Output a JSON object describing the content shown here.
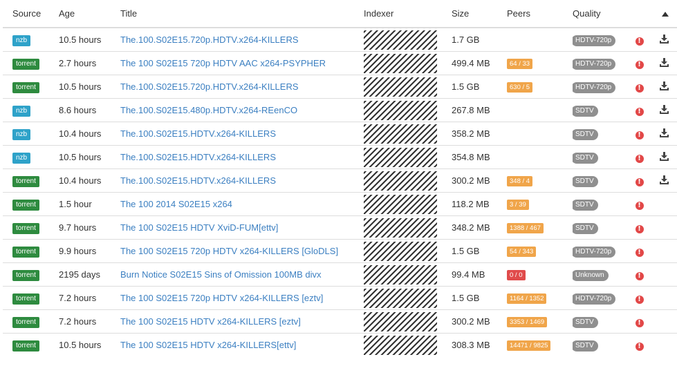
{
  "headers": {
    "source": "Source",
    "age": "Age",
    "title": "Title",
    "indexer": "Indexer",
    "size": "Size",
    "peers": "Peers",
    "quality": "Quality"
  },
  "colors": {
    "nzb": "#2ea2c9",
    "torrent": "#2e8b3f",
    "title_link": "#3b7fc1",
    "peers_warning": "#f0a54a",
    "peers_danger": "#e04b4b",
    "quality_badge": "#8f8f8f",
    "warning_icon": "#e24747"
  },
  "releases": [
    {
      "source": "nzb",
      "age": "10.5 hours",
      "title": "The.100.S02E15.720p.HDTV.x264-KILLERS",
      "size": "1.7 GB",
      "peers": "",
      "peers_status": "",
      "quality": "HDTV-720p",
      "download": true
    },
    {
      "source": "torrent",
      "age": "2.7 hours",
      "title": "The 100 S02E15 720p HDTV AAC x264-PSYPHER",
      "size": "499.4 MB",
      "peers": "64 / 33",
      "peers_status": "warning",
      "quality": "HDTV-720p",
      "download": true
    },
    {
      "source": "torrent",
      "age": "10.5 hours",
      "title": "The.100.S02E15.720p.HDTV.x264-KILLERS",
      "size": "1.5 GB",
      "peers": "630 / 5",
      "peers_status": "warning",
      "quality": "HDTV-720p",
      "download": true
    },
    {
      "source": "nzb",
      "age": "8.6 hours",
      "title": "The.100.S02E15.480p.HDTV.x264-REenCO",
      "size": "267.8 MB",
      "peers": "",
      "peers_status": "",
      "quality": "SDTV",
      "download": true
    },
    {
      "source": "nzb",
      "age": "10.4 hours",
      "title": "The.100.S02E15.HDTV.x264-KILLERS",
      "size": "358.2 MB",
      "peers": "",
      "peers_status": "",
      "quality": "SDTV",
      "download": true
    },
    {
      "source": "nzb",
      "age": "10.5 hours",
      "title": "The.100.S02E15.HDTV.x264-KILLERS",
      "size": "354.8 MB",
      "peers": "",
      "peers_status": "",
      "quality": "SDTV",
      "download": true
    },
    {
      "source": "torrent",
      "age": "10.4 hours",
      "title": "The.100.S02E15.HDTV.x264-KILLERS",
      "size": "300.2 MB",
      "peers": "348 / 4",
      "peers_status": "warning",
      "quality": "SDTV",
      "download": true
    },
    {
      "source": "torrent",
      "age": "1.5 hour",
      "title": "The 100 2014 S02E15 x264",
      "size": "118.2 MB",
      "peers": "3 / 39",
      "peers_status": "warning",
      "quality": "SDTV",
      "download": false
    },
    {
      "source": "torrent",
      "age": "9.7 hours",
      "title": "The 100 S02E15 HDTV XviD-FUM[ettv]",
      "size": "348.2 MB",
      "peers": "1388 / 467",
      "peers_status": "warning",
      "quality": "SDTV",
      "download": false
    },
    {
      "source": "torrent",
      "age": "9.9 hours",
      "title": "The 100 S02E15 720p HDTV x264-KILLERS [GloDLS]",
      "size": "1.5 GB",
      "peers": "54 / 343",
      "peers_status": "warning",
      "quality": "HDTV-720p",
      "download": false
    },
    {
      "source": "torrent",
      "age": "2195 days",
      "title": "Burn Notice S02E15 Sins of Omission 100MB divx",
      "size": "99.4 MB",
      "peers": "0 / 0",
      "peers_status": "danger",
      "quality": "Unknown",
      "download": false
    },
    {
      "source": "torrent",
      "age": "7.2 hours",
      "title": "The 100 S02E15 720p HDTV x264-KILLERS [eztv]",
      "size": "1.5 GB",
      "peers": "1164 / 1352",
      "peers_status": "warning",
      "quality": "HDTV-720p",
      "download": false
    },
    {
      "source": "torrent",
      "age": "7.2 hours",
      "title": "The 100 S02E15 HDTV x264-KILLERS [eztv]",
      "size": "300.2 MB",
      "peers": "3353 / 1469",
      "peers_status": "warning",
      "quality": "SDTV",
      "download": false
    },
    {
      "source": "torrent",
      "age": "10.5 hours",
      "title": "The 100 S02E15 HDTV x264-KILLERS[ettv]",
      "size": "308.3 MB",
      "peers": "14471 / 9825",
      "peers_status": "warning",
      "quality": "SDTV",
      "download": false
    }
  ]
}
